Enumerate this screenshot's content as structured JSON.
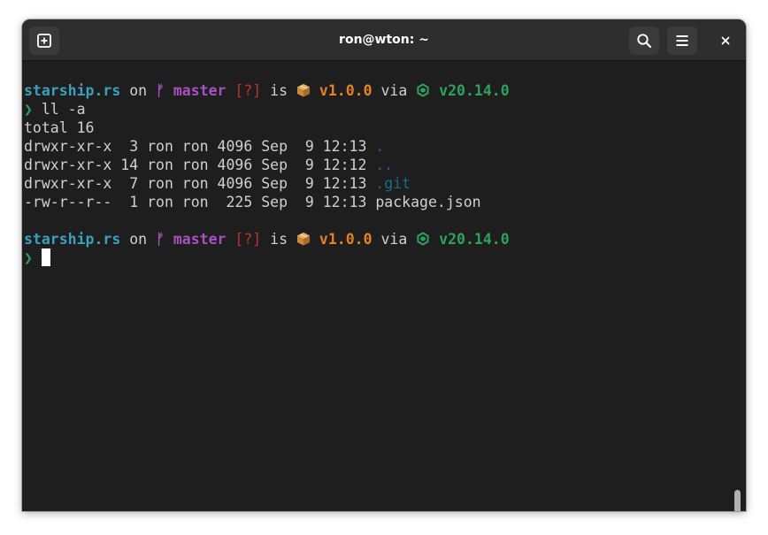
{
  "window": {
    "title": "ron@wton: ~"
  },
  "headerbar": {
    "new_tab_icon": "new-tab-icon",
    "search_icon": "search-icon",
    "menu_icon": "hamburger-menu-icon",
    "close_glyph": "×"
  },
  "colors": {
    "background": "#1e1e1e",
    "directory": "#3aa0bf",
    "branch": "#a851c3",
    "git_status": "#c0302f",
    "package": "#e5821f",
    "node": "#30a15c",
    "dot_dirs": "#1c6a8f"
  },
  "prompt": {
    "directory": "starship.rs",
    "on": "on",
    "branch_symbol": "ᚠ",
    "branch": "master",
    "status": "[?]",
    "is": "is",
    "package_icon": "package-box-icon",
    "package_version": "v1.0.0",
    "via": "via",
    "node_icon": "nodejs-hexagon-icon",
    "node_version": "v20.14.0",
    "arrow": "❯"
  },
  "command": "ll -a",
  "output": {
    "total": "total 16",
    "rows": [
      {
        "meta": "drwxr-xr-x  3 ron ron 4096 Sep  9 12:13",
        "name": "."
      },
      {
        "meta": "drwxr-xr-x 14 ron ron 4096 Sep  9 12:12",
        "name": ".."
      },
      {
        "meta": "drwxr-xr-x  7 ron ron 4096 Sep  9 12:13",
        "name": ".git"
      },
      {
        "meta": "-rw-r--r--  1 ron ron  225 Sep  9 12:13",
        "name": "package.json"
      }
    ]
  }
}
